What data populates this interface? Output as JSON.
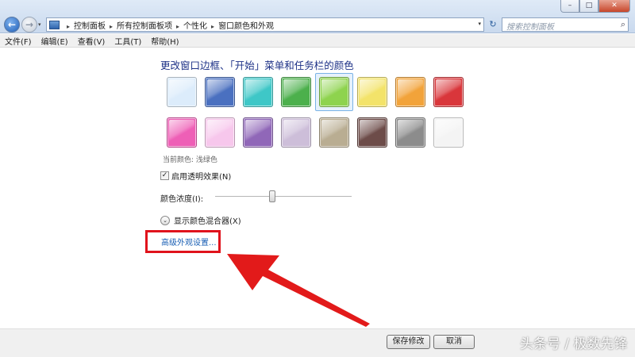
{
  "window": {
    "minimize_label": "–",
    "maximize_label": "□",
    "close_label": "✕"
  },
  "nav": {
    "back_glyph": "←",
    "forward_glyph": "→",
    "dropdown_glyph": "▾"
  },
  "address": {
    "breadcrumbs": [
      "控制面板",
      "所有控制面板项",
      "个性化",
      "窗口颜色和外观"
    ],
    "separator": "▸",
    "dropdown_glyph": "▾",
    "refresh_glyph": "↻"
  },
  "search": {
    "placeholder": "搜索控制面板",
    "icon_glyph": "⌕"
  },
  "menubar": {
    "items": [
      "文件(F)",
      "编辑(E)",
      "查看(V)",
      "工具(T)",
      "帮助(H)"
    ]
  },
  "main": {
    "heading": "更改窗口边框、「开始」菜单和任务栏的颜色",
    "colors": [
      {
        "name": "sky",
        "color": "#dcecfb"
      },
      {
        "name": "twilight",
        "color": "#4a70c0"
      },
      {
        "name": "sea",
        "color": "#3ec7c7"
      },
      {
        "name": "leaf",
        "color": "#4cb04c"
      },
      {
        "name": "lime",
        "color": "#8ed34e",
        "selected": true
      },
      {
        "name": "lemon",
        "color": "#f3e36a"
      },
      {
        "name": "pumpkin",
        "color": "#f2a33a"
      },
      {
        "name": "ruby",
        "color": "#d9363b"
      },
      {
        "name": "fuchsia",
        "color": "#ee5fb6"
      },
      {
        "name": "blush",
        "color": "#f7c7ec"
      },
      {
        "name": "violet",
        "color": "#9067b8"
      },
      {
        "name": "lavender",
        "color": "#cdbed9"
      },
      {
        "name": "taupe",
        "color": "#b9ad92"
      },
      {
        "name": "chocolate",
        "color": "#6d4c49"
      },
      {
        "name": "slate",
        "color": "#8c8c8c"
      },
      {
        "name": "frost",
        "color": "#f4f4f4"
      }
    ],
    "current_color_label": "当前颜色: 浅绿色",
    "transparency": {
      "label": "启用透明效果(N)",
      "checked": true,
      "check_glyph": "✓"
    },
    "intensity": {
      "label": "颜色浓度(I):",
      "value": 0.42
    },
    "mixer": {
      "label": "显示颜色混合器(X)",
      "glyph": "⌄"
    },
    "advanced_link": "高级外观设置..."
  },
  "footer": {
    "save_label": "保存修改",
    "cancel_label": "取消"
  },
  "watermark": "头条号 / 极数先锋",
  "accent": {
    "highlight": "#e0131c",
    "link": "#1a5fb4"
  }
}
